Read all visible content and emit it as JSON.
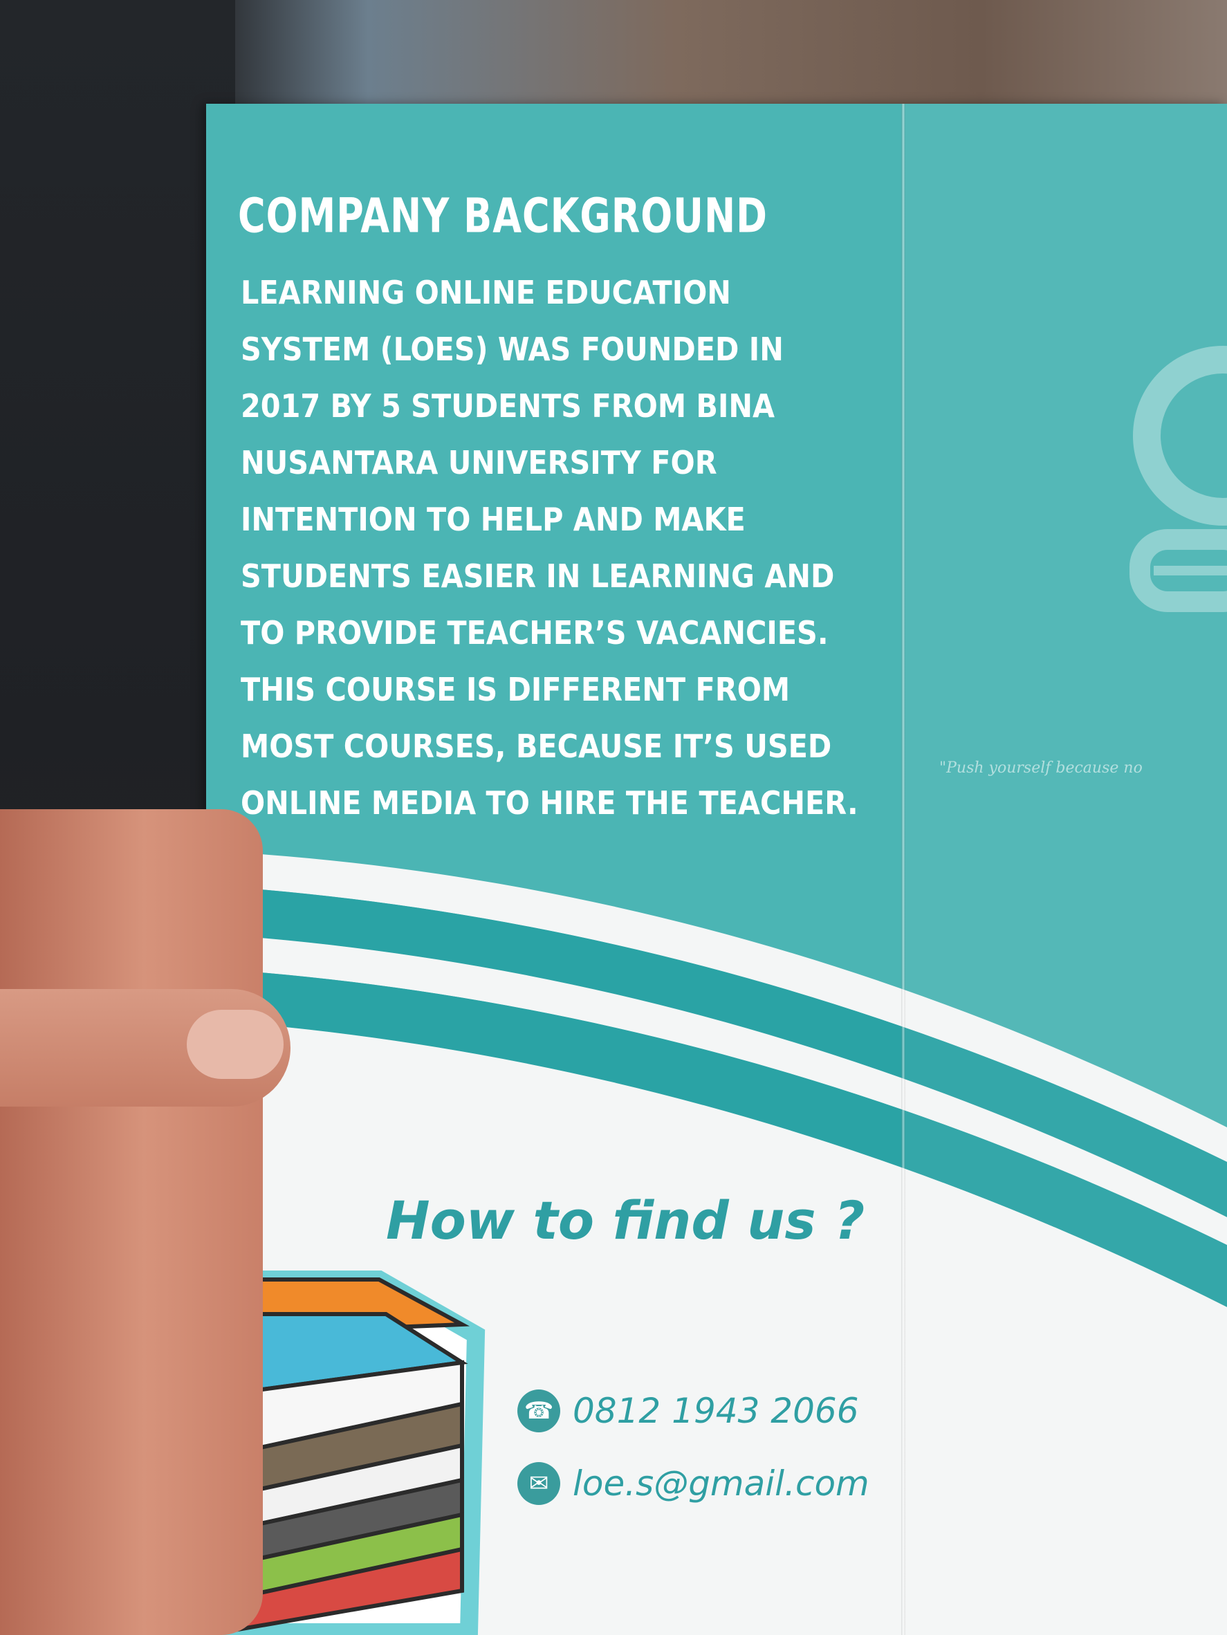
{
  "flyer": {
    "heading": "COMPANY BACKGROUND",
    "body": "LEARNING ONLINE EDUCATION SYSTEM (LOES) WAS FOUNDED IN 2017 BY 5 STUDENTS FROM BINA NUSANTARA UNIVERSITY FOR INTENTION TO HELP AND MAKE STUDENTS EASIER IN LEARNING AND TO PROVIDE TEACHER’S VACANCIES. THIS COURSE IS DIFFERENT FROM MOST COURSES, BECAUSE IT’S USED ONLINE MEDIA TO HIRE THE TEACHER.",
    "find_us_title": "How to find us ?",
    "phone": "0812 1943 2066",
    "email": "loe.s@gmail.com",
    "quote_fragment": "\"Push yourself because no"
  },
  "icons": {
    "phone": "phone-icon",
    "email": "envelope-icon",
    "books": "book-stack-illustration",
    "apple": "apple-on-books-icon"
  },
  "colors": {
    "teal": "#4bb5b4",
    "stripe": "#2aa3a5",
    "text_teal": "#2f9fa3"
  }
}
